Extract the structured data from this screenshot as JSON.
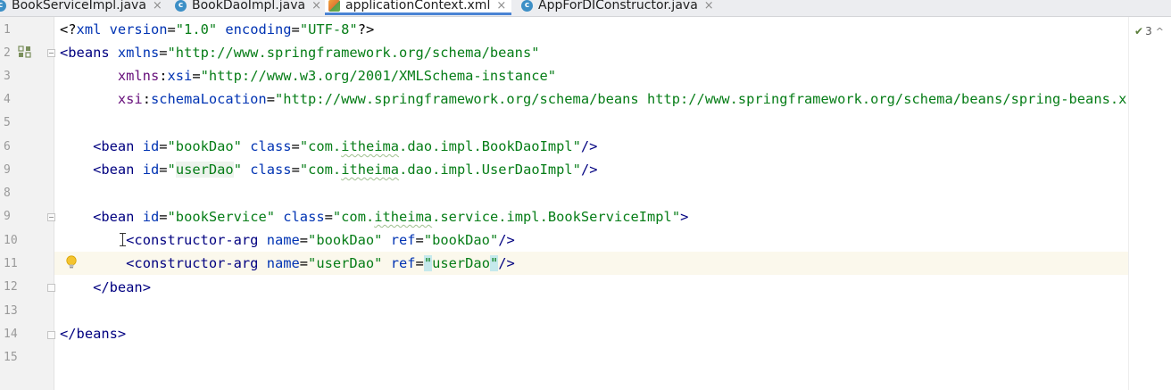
{
  "tabs": [
    {
      "label": "BookServiceImpl.java",
      "icon": "java-class-icon",
      "active": false
    },
    {
      "label": "BookDaoImpl.java",
      "icon": "java-class-icon",
      "active": false
    },
    {
      "label": "applicationContext.xml",
      "icon": "xml-file-icon",
      "active": true
    },
    {
      "label": "AppForDIConstructor.java",
      "icon": "java-class-icon",
      "active": false
    }
  ],
  "tab_close_glyph": "×",
  "java_icon_glyph": "c",
  "line_numbers": [
    "1",
    "2",
    "3",
    "4",
    "5",
    "6",
    "9",
    "8",
    "9",
    "10",
    "11",
    "12",
    "13",
    "14",
    "15"
  ],
  "code": {
    "l1": {
      "open": "<?",
      "name": "xml",
      "a1": " version",
      "eq1": "=",
      "v1": "\"1.0\"",
      "a2": " encoding",
      "eq2": "=",
      "v2": "\"UTF-8\"",
      "close": "?>"
    },
    "l2": {
      "open": "<",
      "tag": "beans",
      "attr": " xmlns",
      "eq": "=",
      "val": "\"http://www.springframework.org/schema/beans\""
    },
    "l3": {
      "indent": "       ",
      "prefix": "xmlns",
      "colon": ":",
      "attr": "xsi",
      "eq": "=",
      "val": "\"http://www.w3.org/2001/XMLSchema-instance\""
    },
    "l4": {
      "indent": "       ",
      "prefix": "xsi",
      "colon": ":",
      "attr": "schemaLocation",
      "eq": "=",
      "val": "\"http://www.springframework.org/schema/beans http://www.springframework.org/schema/beans/spring-beans.xsd\"",
      "close": ">"
    },
    "l6": {
      "indent": "    ",
      "open": "<",
      "tag": "bean",
      "a1": " id",
      "eq1": "=",
      "v1": "\"bookDao\"",
      "a2": " class",
      "eq2": "=",
      "v2a": "\"com.",
      "v2b": "itheima",
      "v2c": ".dao.impl.BookDaoImpl\"",
      "close": "/>"
    },
    "l7": {
      "indent": "    ",
      "open": "<",
      "tag": "bean",
      "a1": " id",
      "eq1": "=",
      "v1a": "\"",
      "v1b": "userDao",
      "v1c": "\"",
      "a2": " class",
      "eq2": "=",
      "v2a": "\"com.",
      "v2b": "itheima",
      "v2c": ".dao.impl.UserDaoImpl\"",
      "close": "/>"
    },
    "l9": {
      "indent": "    ",
      "open": "<",
      "tag": "bean",
      "a1": " id",
      "eq1": "=",
      "v1": "\"bookService\"",
      "a2": " class",
      "eq2": "=",
      "v2a": "\"com.",
      "v2b": "itheima",
      "v2c": ".service.impl.BookServiceImpl\"",
      "close": ">"
    },
    "l10": {
      "indent": "        ",
      "open": "<",
      "tag": "constructor-arg",
      "a1": " name",
      "eq1": "=",
      "v1": "\"bookDao\"",
      "a2": " ref",
      "eq2": "=",
      "v2": "\"bookDao\"",
      "close": "/>"
    },
    "l11": {
      "indent": "        ",
      "open": "<",
      "tag": "constructor-arg",
      "a1": " name",
      "eq1": "=",
      "v1": "\"userDao\"",
      "a2": " ref",
      "eq2": "=",
      "q1": "\"",
      "v2": "userDao",
      "q2": "\"",
      "close": "/>"
    },
    "l12": {
      "indent": "    ",
      "open": "</",
      "tag": "bean",
      "close": ">"
    },
    "l14": {
      "open": "</",
      "tag": "beans",
      "close": ">"
    }
  },
  "inspection": {
    "count": "3",
    "icon": "check-warning-icon",
    "chevron": "^"
  }
}
